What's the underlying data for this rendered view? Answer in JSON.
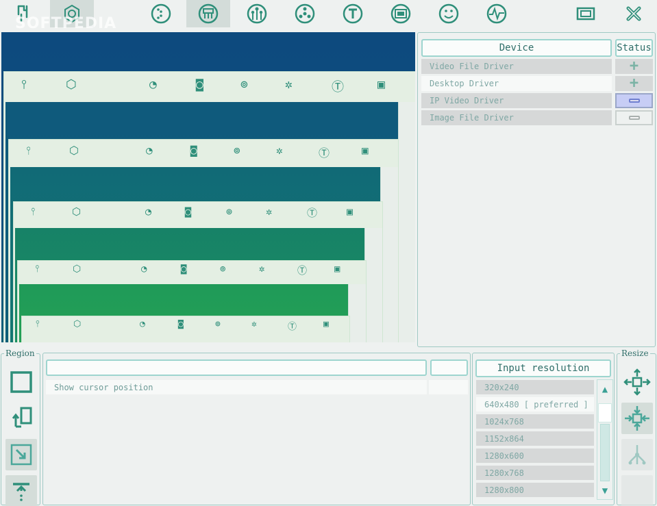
{
  "watermark": "SOFTPEDIA",
  "toolbar": {
    "icons": [
      "split-plug-icon",
      "gear-nut-icon",
      "dotted-circle-icon",
      "capture-device-icon",
      "network-tree-icon",
      "asterisk-circle-icon",
      "text-tool-icon",
      "monitor-icon",
      "smiley-icon",
      "pulse-icon",
      "window-icon",
      "close-icon"
    ]
  },
  "device_panel": {
    "headers": {
      "device": "Device",
      "status": "Status"
    },
    "rows": [
      {
        "name": "Video File Driver",
        "status": "+"
      },
      {
        "name": "Desktop Driver",
        "status": "+"
      },
      {
        "name": "IP Video Driver",
        "status": "-"
      },
      {
        "name": "Image File Driver",
        "status": "-"
      }
    ]
  },
  "region": {
    "legend": "Region"
  },
  "resize": {
    "legend": "Resize"
  },
  "middle": {
    "row_label": "Show cursor position"
  },
  "resolution": {
    "header": "Input resolution",
    "items": [
      "320x240",
      "640x480 [ preferred ]",
      "1024x768",
      "1152x864",
      "1280x600",
      "1280x768",
      "1280x800"
    ]
  },
  "colors": {
    "accent": "#2f8f7a",
    "border": "#9dd5cf",
    "preview_blue": "#0d4a7e",
    "highlight": "#c7cdf5"
  }
}
